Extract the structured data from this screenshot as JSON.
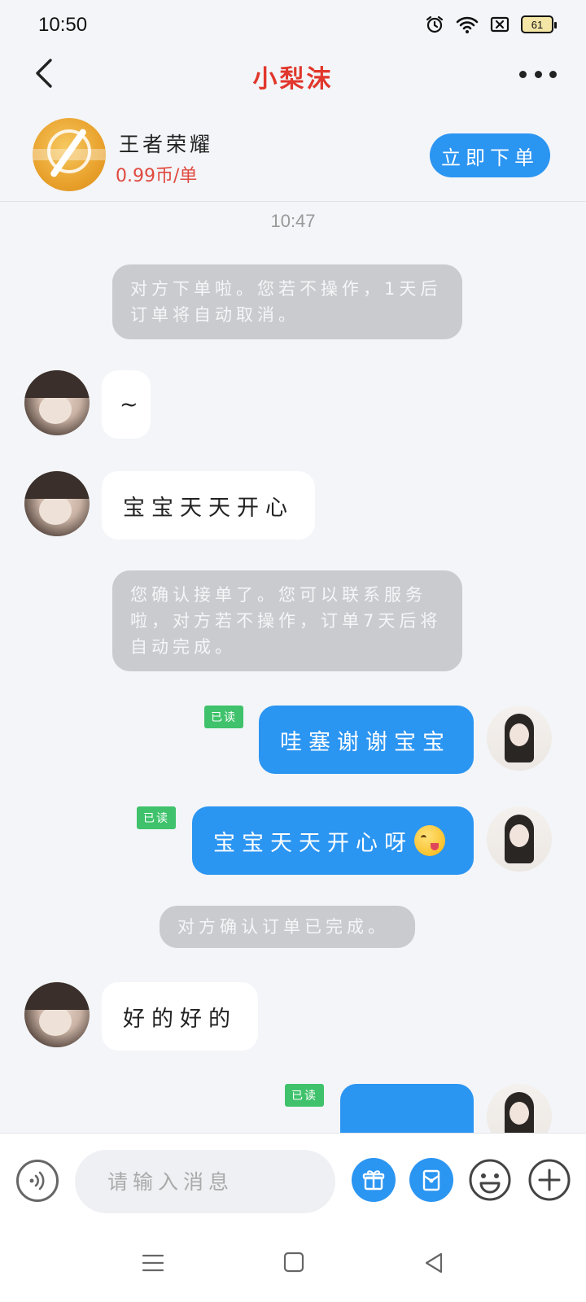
{
  "status_bar": {
    "time": "10:50",
    "battery_level": "61",
    "icons": [
      "alarm-icon",
      "wifi-icon",
      "sim-none-icon",
      "battery-icon"
    ]
  },
  "header": {
    "title": "小梨沫",
    "title_color": "#e1372c",
    "back_icon": "chevron-left-icon",
    "more_icon": "more-horizontal-icon"
  },
  "order_card": {
    "game_name": "王者荣耀",
    "price": "0.99币/单",
    "order_button": "立即下单",
    "accent_color": "#2b95f2",
    "price_color": "#e0493f"
  },
  "chat": {
    "timestamp": "10:47",
    "messages": [
      {
        "type": "system",
        "text": "对方下单啦。您若不操作，1天后订单将自动取消。"
      },
      {
        "type": "incoming",
        "text": "~"
      },
      {
        "type": "incoming",
        "text": "宝宝天天开心"
      },
      {
        "type": "system",
        "text": "您确认接单了。您可以联系服务啦，对方若不操作，订单7天后将自动完成。"
      },
      {
        "type": "outgoing",
        "text": "哇塞谢谢宝宝",
        "read": "已读"
      },
      {
        "type": "outgoing",
        "text": "宝宝天天开心呀",
        "emoji": "yum-face-emoji",
        "read": "已读"
      },
      {
        "type": "system",
        "text": "对方确认订单已完成。"
      },
      {
        "type": "incoming",
        "text": "好的好的"
      },
      {
        "type": "outgoing",
        "text": "",
        "read": "已读",
        "partially_visible": true
      }
    ]
  },
  "composer": {
    "placeholder": "请输入消息",
    "icons": [
      "voice-icon",
      "gift-icon",
      "red-packet-icon",
      "emoji-icon",
      "plus-icon"
    ]
  },
  "nav_bar": {
    "icons": [
      "menu-icon",
      "home-icon",
      "back-icon"
    ]
  }
}
